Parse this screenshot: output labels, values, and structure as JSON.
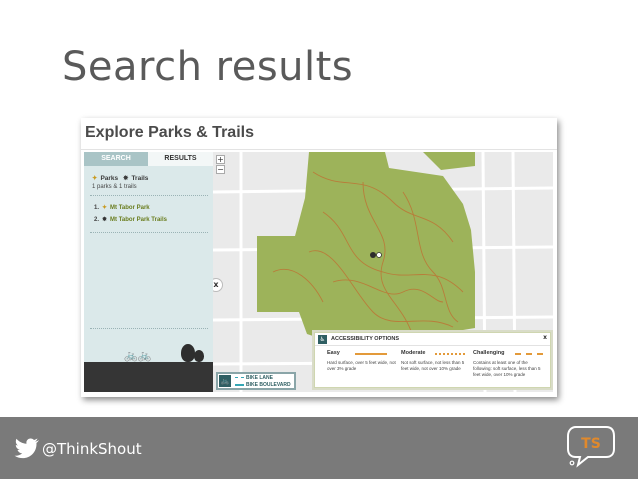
{
  "slide": {
    "title": "Search results",
    "twitter_handle": "@ThinkShout",
    "logo_text": "TS"
  },
  "app": {
    "title": "Explore Parks & Trails",
    "tabs": [
      "SEARCH",
      "RESULTS"
    ],
    "legend": {
      "parks": "Parks",
      "trails": "Trails"
    },
    "result_count": "1 parks & 1 trails",
    "results": [
      {
        "num": "1.",
        "name": "Mt Tabor Park"
      },
      {
        "num": "2.",
        "name": "Mt Tabor Park Trails"
      }
    ],
    "zoom_in": "+",
    "zoom_out": "−",
    "close": "x"
  },
  "bike_legend": {
    "lane": "BIKE LANE",
    "boulevard": "BIKE BOULEVARD"
  },
  "accessibility": {
    "title": "ACCESSIBILITY OPTIONS",
    "close": "x",
    "levels": [
      {
        "name": "Easy",
        "desc": "Hard surface, over 5 feet wide, not over 3% grade",
        "color": "#e39a3a"
      },
      {
        "name": "Moderate",
        "desc": "Not soft surface, not less than 5 feet wide, not over 10% grade",
        "color": "#e39a3a"
      },
      {
        "name": "Challenging",
        "desc": "Contains at least one of the following: soft surface, less than 5 feet wide, over 10% grade",
        "color": "#e39a3a"
      }
    ]
  },
  "colors": {
    "park_green": "#9db35a",
    "trail_orange": "#c98a3c",
    "footer_gray": "#7a7a7a",
    "panel_teal": "#dbe9ea"
  }
}
